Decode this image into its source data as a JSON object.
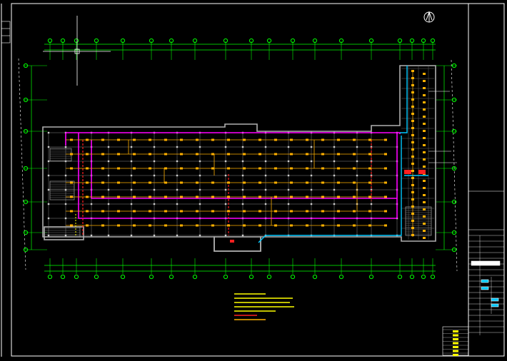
{
  "drawing": {
    "background": "#000000",
    "colors": {
      "frame": "#ffffff",
      "wall": "#a8a8a8",
      "grid": "#d0d0d0",
      "dimension": "#00ff00",
      "axis_bubble": "#00ff00",
      "lighting_circuit": "#ffb000",
      "circuit_magenta": "#ff00ff",
      "circuit_red": "#ff2020",
      "circuit_cyan": "#00c8ff",
      "notes": "#ffff00"
    },
    "north_arrow": "north-arrow",
    "crosshair": "cad-crosshair-cursor"
  },
  "title_block": {
    "legend_rows": 5
  }
}
